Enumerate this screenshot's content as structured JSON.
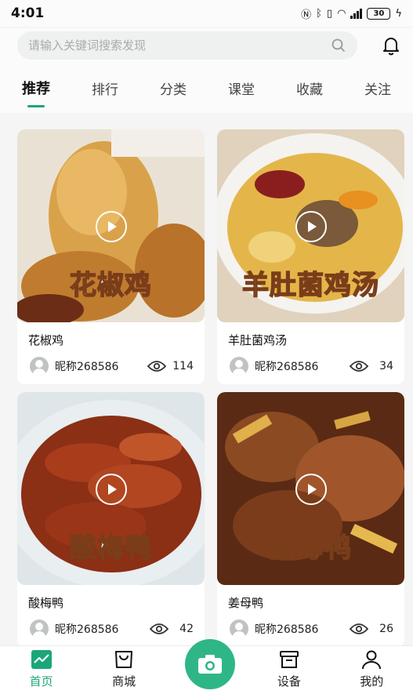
{
  "status_bar": {
    "time": "4:01",
    "battery": "30",
    "net_speed": "46"
  },
  "search": {
    "placeholder": "请输入关键词搜索发现"
  },
  "tabs": [
    {
      "label": "推荐",
      "active": true
    },
    {
      "label": "排行",
      "active": false
    },
    {
      "label": "分类",
      "active": false
    },
    {
      "label": "课堂",
      "active": false
    },
    {
      "label": "收藏",
      "active": false
    },
    {
      "label": "关注",
      "active": false
    }
  ],
  "cards": [
    {
      "overlay": "花椒鸡",
      "title": "花椒鸡",
      "author": "昵称268586",
      "views": "114"
    },
    {
      "overlay": "羊肚菌鸡汤",
      "title": "羊肚菌鸡汤",
      "author": "昵称268586",
      "views": "34"
    },
    {
      "overlay": "酸梅鸭",
      "title": "酸梅鸭",
      "author": "昵称268586",
      "views": "42"
    },
    {
      "overlay": "姜母鸭",
      "title": "姜母鸭",
      "author": "昵称268586",
      "views": "26"
    }
  ],
  "nav": [
    {
      "label": "首页",
      "icon": "home-chart-icon",
      "active": true
    },
    {
      "label": "商城",
      "icon": "shopping-bag-icon",
      "active": false
    },
    {
      "label": "",
      "icon": "camera-icon",
      "active": false
    },
    {
      "label": "设备",
      "icon": "device-box-icon",
      "active": false
    },
    {
      "label": "我的",
      "icon": "profile-icon",
      "active": false
    }
  ],
  "colors": {
    "accent": "#1ba67a",
    "camera_button": "#2fb687"
  }
}
